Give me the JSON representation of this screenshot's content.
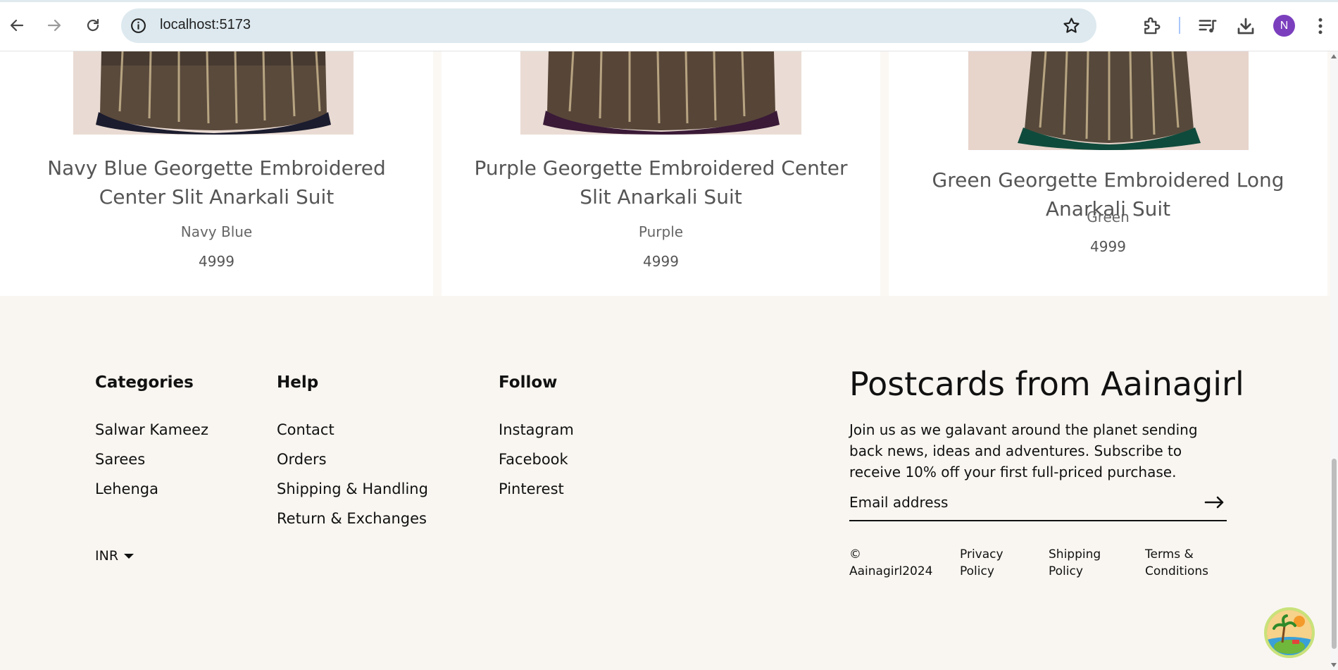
{
  "browser": {
    "url": "localhost:5173",
    "profile_initial": "N"
  },
  "products": [
    {
      "title": "Navy Blue Georgette Embroidered Center Slit Anarkali Suit",
      "color": "Navy Blue",
      "price": "4999",
      "accent": "#1b1c2e"
    },
    {
      "title": "Purple Georgette Embroidered Center Slit Anarkali Suit",
      "color": "Purple",
      "price": "4999",
      "accent": "#3a1a37"
    },
    {
      "title": "Green Georgette Embroidered Long Anarkali Suit",
      "color": "Green",
      "price": "4999",
      "accent": "#0f4b3c"
    }
  ],
  "footer": {
    "categories": {
      "title": "Categories",
      "links": [
        "Salwar Kameez",
        "Sarees",
        "Lehenga"
      ]
    },
    "help": {
      "title": "Help",
      "links": [
        "Contact",
        "Orders",
        "Shipping & Handling",
        "Return & Exchanges"
      ]
    },
    "follow": {
      "title": "Follow",
      "links": [
        "Instagram",
        "Facebook",
        "Pinterest"
      ]
    },
    "currency": "INR",
    "newsletter": {
      "title": "Postcards from Aainagirl",
      "text": "Join us as we galavant around the planet sending back news, ideas and adventures. Subscribe to receive 10% off your first full-priced purchase.",
      "email_placeholder": "Email address"
    },
    "legal": {
      "copyright": "© Aainagirl2024",
      "privacy": "Privacy Policy",
      "shipping": "Shipping Policy",
      "terms": "Terms & Conditions"
    }
  },
  "icons": {
    "back": "back-arrow-icon",
    "forward": "forward-arrow-icon",
    "reload": "reload-icon",
    "site_info": "info-icon",
    "bookmark": "star-icon",
    "extensions": "puzzle-icon",
    "media": "media-queue-icon",
    "downloads": "download-icon",
    "menu": "kebab-menu-icon",
    "submit": "right-arrow-icon"
  }
}
